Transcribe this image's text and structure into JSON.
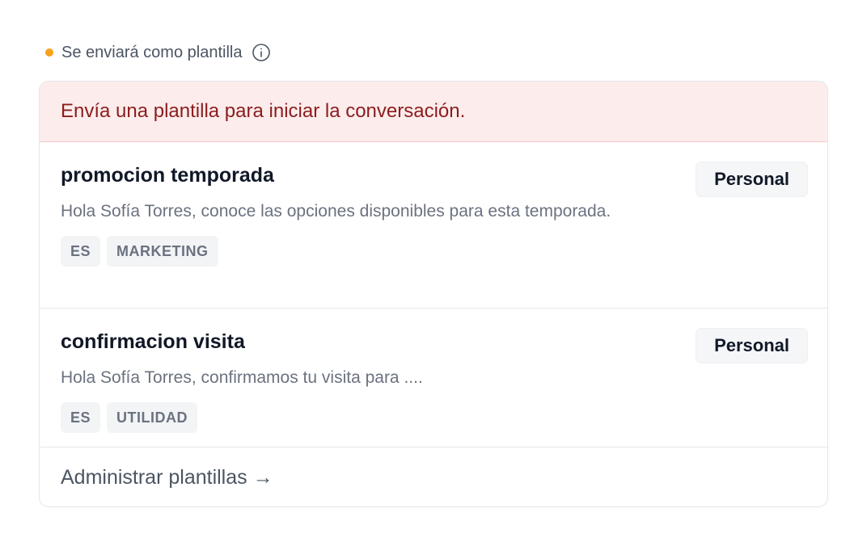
{
  "status": {
    "text": "Se enviará como plantilla",
    "dot_color": "#f5a11a",
    "info_icon": "info-circle-icon"
  },
  "banner": {
    "text": "Envía una plantilla para iniciar la conversación."
  },
  "templates": [
    {
      "name": "promocion temporada",
      "body": "Hola Sofía Torres, conoce las opciones disponibles para esta temporada.",
      "badge": "Personal",
      "tags": [
        "ES",
        "MARKETING"
      ]
    },
    {
      "name": "confirmacion visita",
      "body": "Hola Sofía Torres, confirmamos tu visita para ....",
      "badge": "Personal",
      "tags": [
        "ES",
        "UTILIDAD"
      ]
    }
  ],
  "manage_link": {
    "label": "Administrar plantillas →"
  }
}
